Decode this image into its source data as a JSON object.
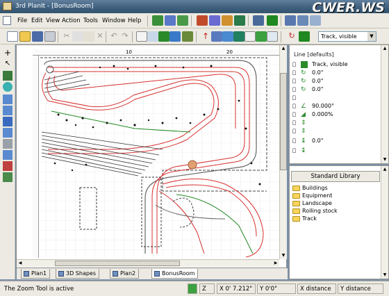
{
  "app": {
    "title": "3rd PlanIt - [BonusRoom]",
    "watermark": "CWER.WS"
  },
  "menu": [
    "File",
    "Edit",
    "View",
    "Action",
    "Tools",
    "Window",
    "Help"
  ],
  "layer_combo": {
    "value": "Track, visible"
  },
  "ruler": {
    "h_labels": [
      "10",
      "20"
    ]
  },
  "tabs": [
    {
      "label": "Plan1",
      "active": false
    },
    {
      "label": "3D Shapes",
      "active": false
    },
    {
      "label": "Plan2",
      "active": false
    },
    {
      "label": "BonusRoom",
      "active": true
    }
  ],
  "properties": {
    "header": "Line [defaults]",
    "rows": [
      {
        "icon": "track-layer-icon",
        "value": "Track, visible"
      },
      {
        "icon": "rotation-icon",
        "value": "0.0\""
      },
      {
        "icon": "rotation-icon",
        "value": "0.0\""
      },
      {
        "icon": "rotation-icon",
        "value": "0.0\""
      },
      {
        "icon": "blank",
        "value": ""
      },
      {
        "icon": "angle-icon",
        "value": "90.000°"
      },
      {
        "icon": "grade-icon",
        "value": "0.000%"
      },
      {
        "icon": "elevation-icon",
        "value": ""
      },
      {
        "icon": "elevation-icon",
        "value": ""
      },
      {
        "icon": "height-icon",
        "value": "0.0\""
      },
      {
        "icon": "height-icon",
        "value": ""
      }
    ]
  },
  "library": {
    "header": "Standard Library",
    "items": [
      "Buildings",
      "Equipment",
      "Landscape",
      "Rolling stock",
      "Track"
    ]
  },
  "status": {
    "message": "The Zoom Tool is active",
    "toggle": "Z",
    "x": "X 0' 7.212\"",
    "y": "Y 0'0\"",
    "xdist": "X distance",
    "ydist": "Y distance"
  },
  "colors": {
    "track_red": "#d83030",
    "track_green": "#208820",
    "track_gray": "#666666",
    "folder": "#f6d55c"
  }
}
